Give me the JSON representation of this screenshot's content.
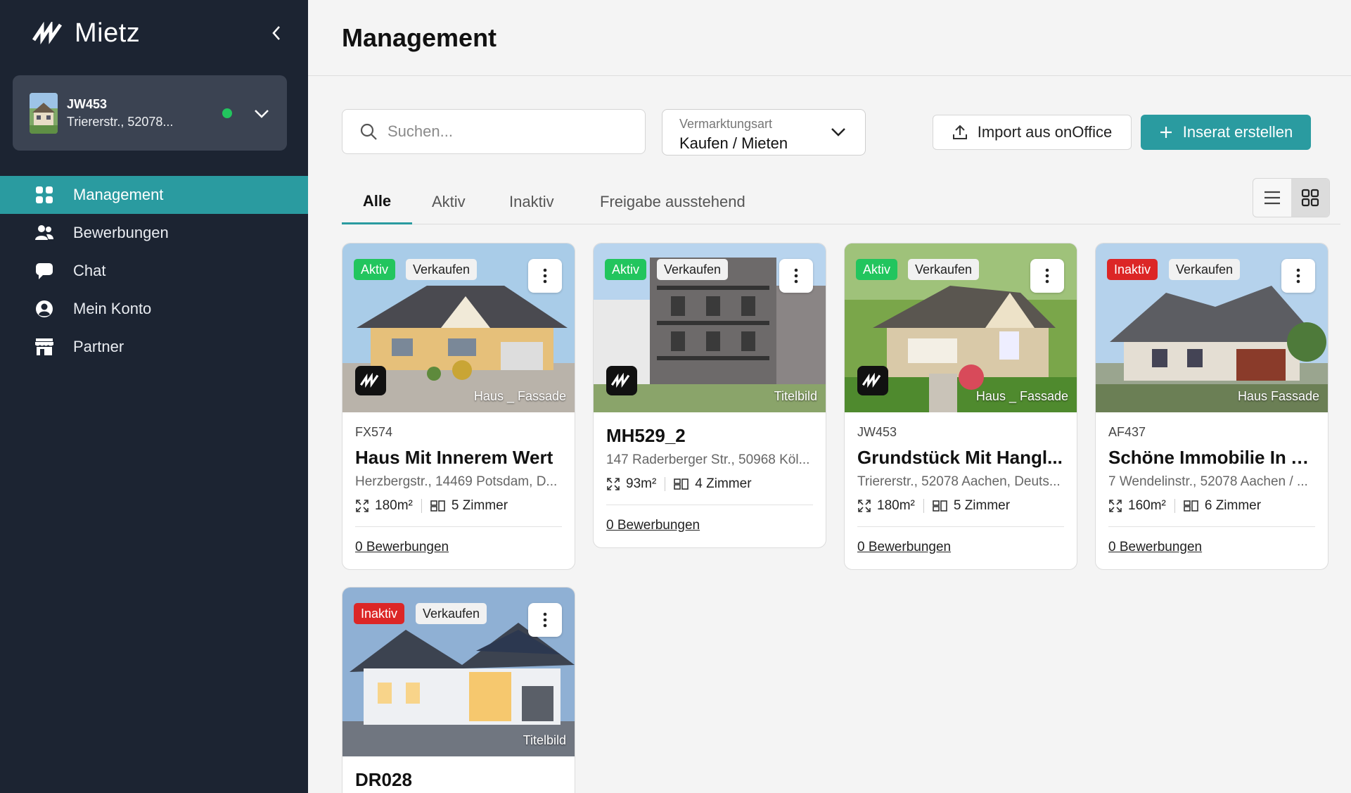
{
  "brand": {
    "name": "Mietz"
  },
  "property_switcher": {
    "code": "JW453",
    "address": "Triererstr., 52078..."
  },
  "nav": [
    {
      "label": "Management",
      "icon": "grid-icon",
      "active": true
    },
    {
      "label": "Bewerbungen",
      "icon": "users-icon",
      "active": false
    },
    {
      "label": "Chat",
      "icon": "chat-icon",
      "active": false
    },
    {
      "label": "Mein Konto",
      "icon": "account-icon",
      "active": false
    },
    {
      "label": "Partner",
      "icon": "store-icon",
      "active": false
    }
  ],
  "page": {
    "title": "Management"
  },
  "search": {
    "placeholder": "Suchen..."
  },
  "filter": {
    "label": "Vermarktungsart",
    "value": "Kaufen / Mieten"
  },
  "actions": {
    "import_label": "Import aus onOffice",
    "create_label": "Inserat erstellen"
  },
  "tabs": [
    {
      "label": "Alle",
      "active": true
    },
    {
      "label": "Aktiv",
      "active": false
    },
    {
      "label": "Inaktiv",
      "active": false
    },
    {
      "label": "Freigabe ausstehend",
      "active": false
    }
  ],
  "colors": {
    "accent": "#2a9ba0",
    "sidebar": "#1c2432",
    "active_badge": "#22c55e",
    "inactive_badge": "#dc2626"
  },
  "listings": [
    {
      "status": "Aktiv",
      "type": "Verkaufen",
      "image_label": "Haus _ Fassade",
      "code": "FX574",
      "title": "Haus Mit Innerem Wert",
      "address": "Herzbergstr., 14469 Potsdam, D...",
      "area": "180m²",
      "rooms": "5 Zimmer",
      "applications": "0 Bewerbungen"
    },
    {
      "status": "Aktiv",
      "type": "Verkaufen",
      "image_label": "Titelbild",
      "code": "MH529_2",
      "title": "",
      "address": "147 Raderberger Str., 50968 Köl...",
      "area": "93m²",
      "rooms": "4 Zimmer",
      "applications": "0 Bewerbungen"
    },
    {
      "status": "Aktiv",
      "type": "Verkaufen",
      "image_label": "Haus _ Fassade",
      "code": "JW453",
      "title": "Grundstück Mit Hangl...",
      "address": "Triererstr., 52078 Aachen, Deuts...",
      "area": "180m²",
      "rooms": "5 Zimmer",
      "applications": "0 Bewerbungen"
    },
    {
      "status": "Inaktiv",
      "type": "Verkaufen",
      "image_label": "Haus Fassade",
      "code": "AF437",
      "title": "Schöne Immobilie In A...",
      "address": "7 Wendelinstr., 52078 Aachen / ...",
      "area": "160m²",
      "rooms": "6 Zimmer",
      "applications": "0 Bewerbungen"
    },
    {
      "status": "Inaktiv",
      "type": "Verkaufen",
      "image_label": "Titelbild",
      "code": "DR028",
      "title": "",
      "address": "",
      "area": "",
      "rooms": "",
      "applications": ""
    }
  ]
}
